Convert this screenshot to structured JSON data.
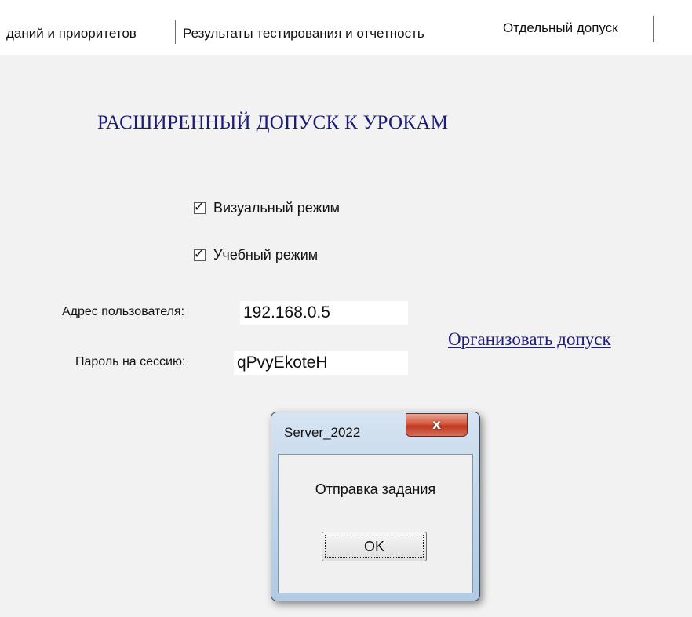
{
  "tabs": [
    {
      "label": "даний и приоритетов"
    },
    {
      "label": "Результаты тестирования и отчетность"
    },
    {
      "label": "Отдельный допуск"
    }
  ],
  "heading": "РАСШИРЕННЫЙ ДОПУСК К УРОКАМ",
  "options": {
    "visual_mode": {
      "label": "Визуальный режим",
      "checked": true
    },
    "study_mode": {
      "label": "Учебный режим",
      "checked": true
    }
  },
  "user_address": {
    "label": "Адрес пользователя:",
    "value": "192.168.0.5"
  },
  "session_password": {
    "label": "Пароль на сессию:",
    "value": "qPvyEkoteH"
  },
  "organize_link": "Организовать допуск",
  "dialog": {
    "title": "Server_2022",
    "close_glyph": "x",
    "message": "Отправка задания",
    "ok_label": "OK"
  },
  "colors": {
    "heading": "#1b1b78",
    "link": "#1b1b78",
    "close_button": "#c94a32"
  }
}
